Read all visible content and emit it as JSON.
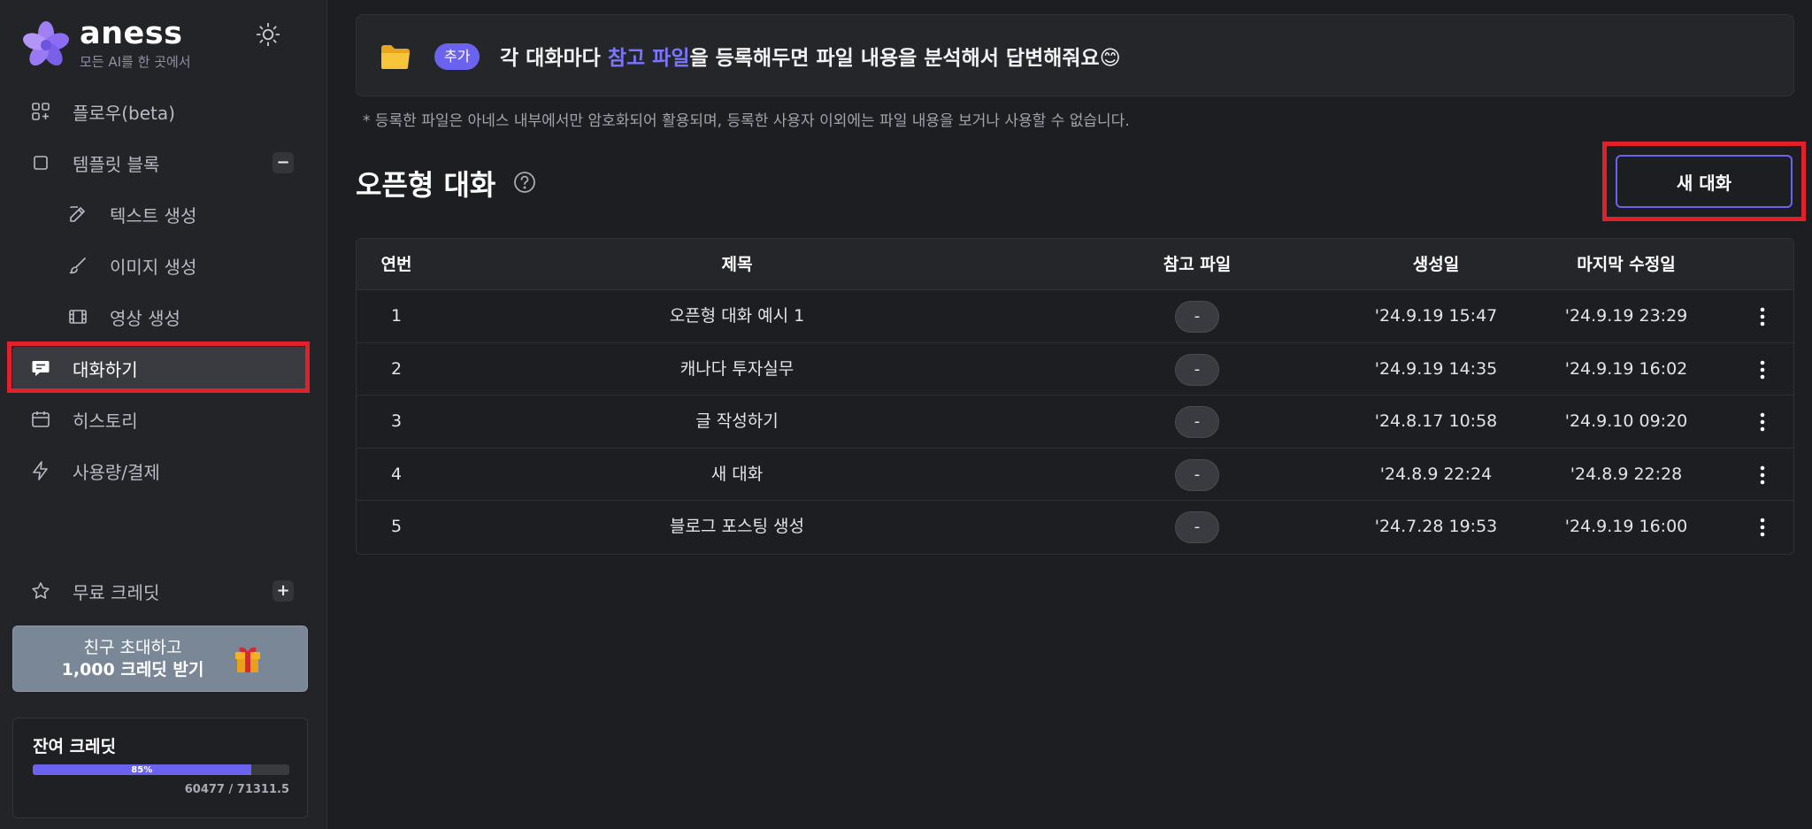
{
  "brand": {
    "name": "aness",
    "tagline": "모든 AI를 한 곳에서",
    "accent_color": "#6b63f0"
  },
  "sidebar": {
    "items": [
      {
        "label": "플로우(beta)",
        "icon": "flow-grid-icon"
      },
      {
        "label": "템플릿 블록",
        "icon": "square-icon",
        "toggle": "−"
      },
      {
        "label": "텍스트 생성",
        "icon": "pencil-icon"
      },
      {
        "label": "이미지 생성",
        "icon": "brush-icon"
      },
      {
        "label": "영상 생성",
        "icon": "film-icon"
      },
      {
        "label": "대화하기",
        "icon": "chat-icon",
        "active": true
      },
      {
        "label": "히스토리",
        "icon": "calendar-icon"
      },
      {
        "label": "사용량/결제",
        "icon": "lightning-icon"
      }
    ],
    "free_credit": {
      "label": "무료 크레딧",
      "toggle": "+"
    },
    "invite": {
      "line1": "친구 초대하고",
      "line2": "1,000 크레딧 받기"
    },
    "credit": {
      "title": "잔여 크레딧",
      "percent_label": "85%",
      "progress_fraction": 0.85,
      "amount": "60477 / 71311.5"
    }
  },
  "banner": {
    "badge": "추가",
    "text_before": "각 대화마다 ",
    "text_accent": "참고 파일",
    "text_after": "을 등록해두면 파일 내용을 분석해서 답변해줘요😊"
  },
  "notice": "* 등록한 파일은 아네스 내부에서만 암호화되어 활용되며, 등록한 사용자 이외에는 파일 내용을 보거나 사용할 수 없습니다.",
  "page": {
    "title": "오픈형 대화",
    "new_button": "새 대화"
  },
  "table": {
    "headers": {
      "no": "연번",
      "title": "제목",
      "file": "참고 파일",
      "created": "생성일",
      "modified": "마지막 수정일"
    },
    "rows": [
      {
        "no": "1",
        "title": "오픈형 대화 예시 1",
        "file": "-",
        "created": "'24.9.19  15:47",
        "modified": "'24.9.19  23:29"
      },
      {
        "no": "2",
        "title": "캐나다 투자실무",
        "file": "-",
        "created": "'24.9.19  14:35",
        "modified": "'24.9.19  16:02"
      },
      {
        "no": "3",
        "title": "글 작성하기",
        "file": "-",
        "created": "'24.8.17  10:58",
        "modified": "'24.9.10  09:20"
      },
      {
        "no": "4",
        "title": "새 대화",
        "file": "-",
        "created": "'24.8.9  22:24",
        "modified": "'24.8.9  22:28"
      },
      {
        "no": "5",
        "title": "블로그 포스팅 생성",
        "file": "-",
        "created": "'24.7.28  19:53",
        "modified": "'24.9.19  16:00"
      }
    ]
  }
}
